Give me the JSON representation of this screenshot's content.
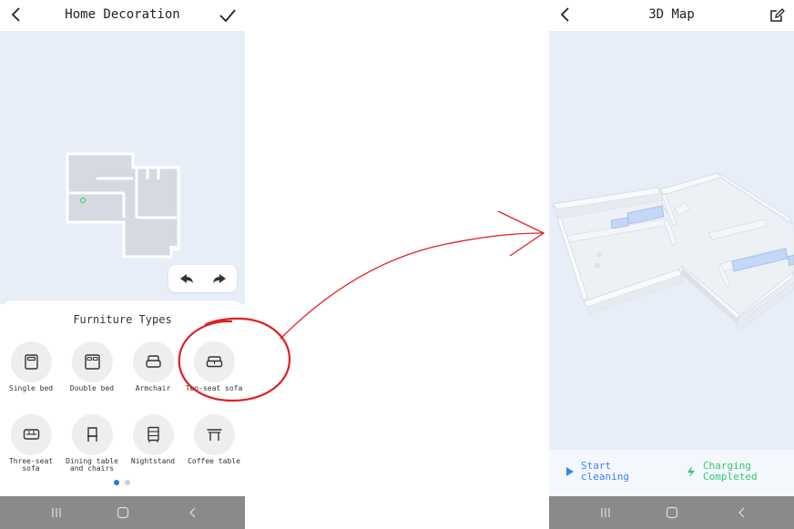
{
  "left_screen": {
    "title": "Home Decoration",
    "back_icon": "chevron-left-icon",
    "confirm_icon": "check-icon",
    "undo_icon": "undo-icon",
    "redo_icon": "redo-icon",
    "sheet_title": "Furniture Types",
    "furniture": [
      {
        "label": "Single bed",
        "icon": "single-bed-icon"
      },
      {
        "label": "Double bed",
        "icon": "double-bed-icon"
      },
      {
        "label": "Armchair",
        "icon": "armchair-icon"
      },
      {
        "label": "Two-seat sofa",
        "icon": "two-seat-sofa-icon"
      },
      {
        "label": "Three-seat sofa",
        "icon": "three-seat-sofa-icon"
      },
      {
        "label": "Dining table and chairs",
        "icon": "dining-chair-icon"
      },
      {
        "label": "Nightstand",
        "icon": "nightstand-icon"
      },
      {
        "label": "Coffee table",
        "icon": "coffee-table-icon"
      }
    ],
    "page_dots": {
      "count": 2,
      "active": 0
    }
  },
  "right_screen": {
    "title": "3D Map",
    "back_icon": "chevron-left-icon",
    "edit_icon": "edit-icon",
    "start_label": "Start cleaning",
    "charging_label": "Charging Completed"
  },
  "colors": {
    "map_bg": "#e8eef8",
    "floor": "#d6dbe4",
    "accent_blue": "#3b82f6",
    "charging_green": "#2ecc71",
    "annotation_red": "#e02020",
    "navbar": "#8a8a8a"
  }
}
